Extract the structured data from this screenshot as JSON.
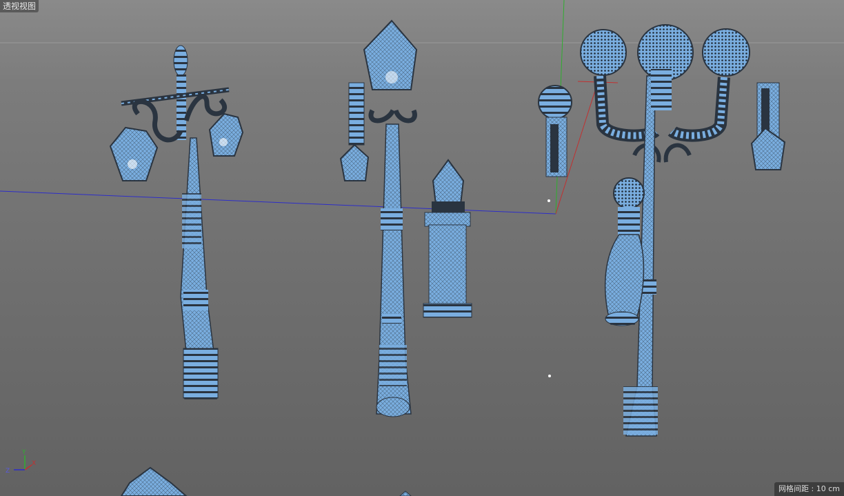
{
  "viewport": {
    "label": "透视视图",
    "grid_spacing": "网格间距 : 10 cm"
  },
  "axis_gizmo": {
    "x": "X",
    "y": "Y",
    "z": "Z"
  },
  "colors": {
    "mesh_fill": "#7aaee0",
    "wire": "#2a3440",
    "x_axis": "#c23030",
    "y_axis": "#2fae2f",
    "z_axis": "#2d2dc8"
  },
  "objects": [
    "lamp-post-double-lantern",
    "lamp-post-single-lantern",
    "wall-lantern-bracket",
    "short-pillar-lantern",
    "wall-globe-sconce",
    "triple-globe-lamp-post",
    "bollard-globe-lamp",
    "wall-lantern-right"
  ]
}
